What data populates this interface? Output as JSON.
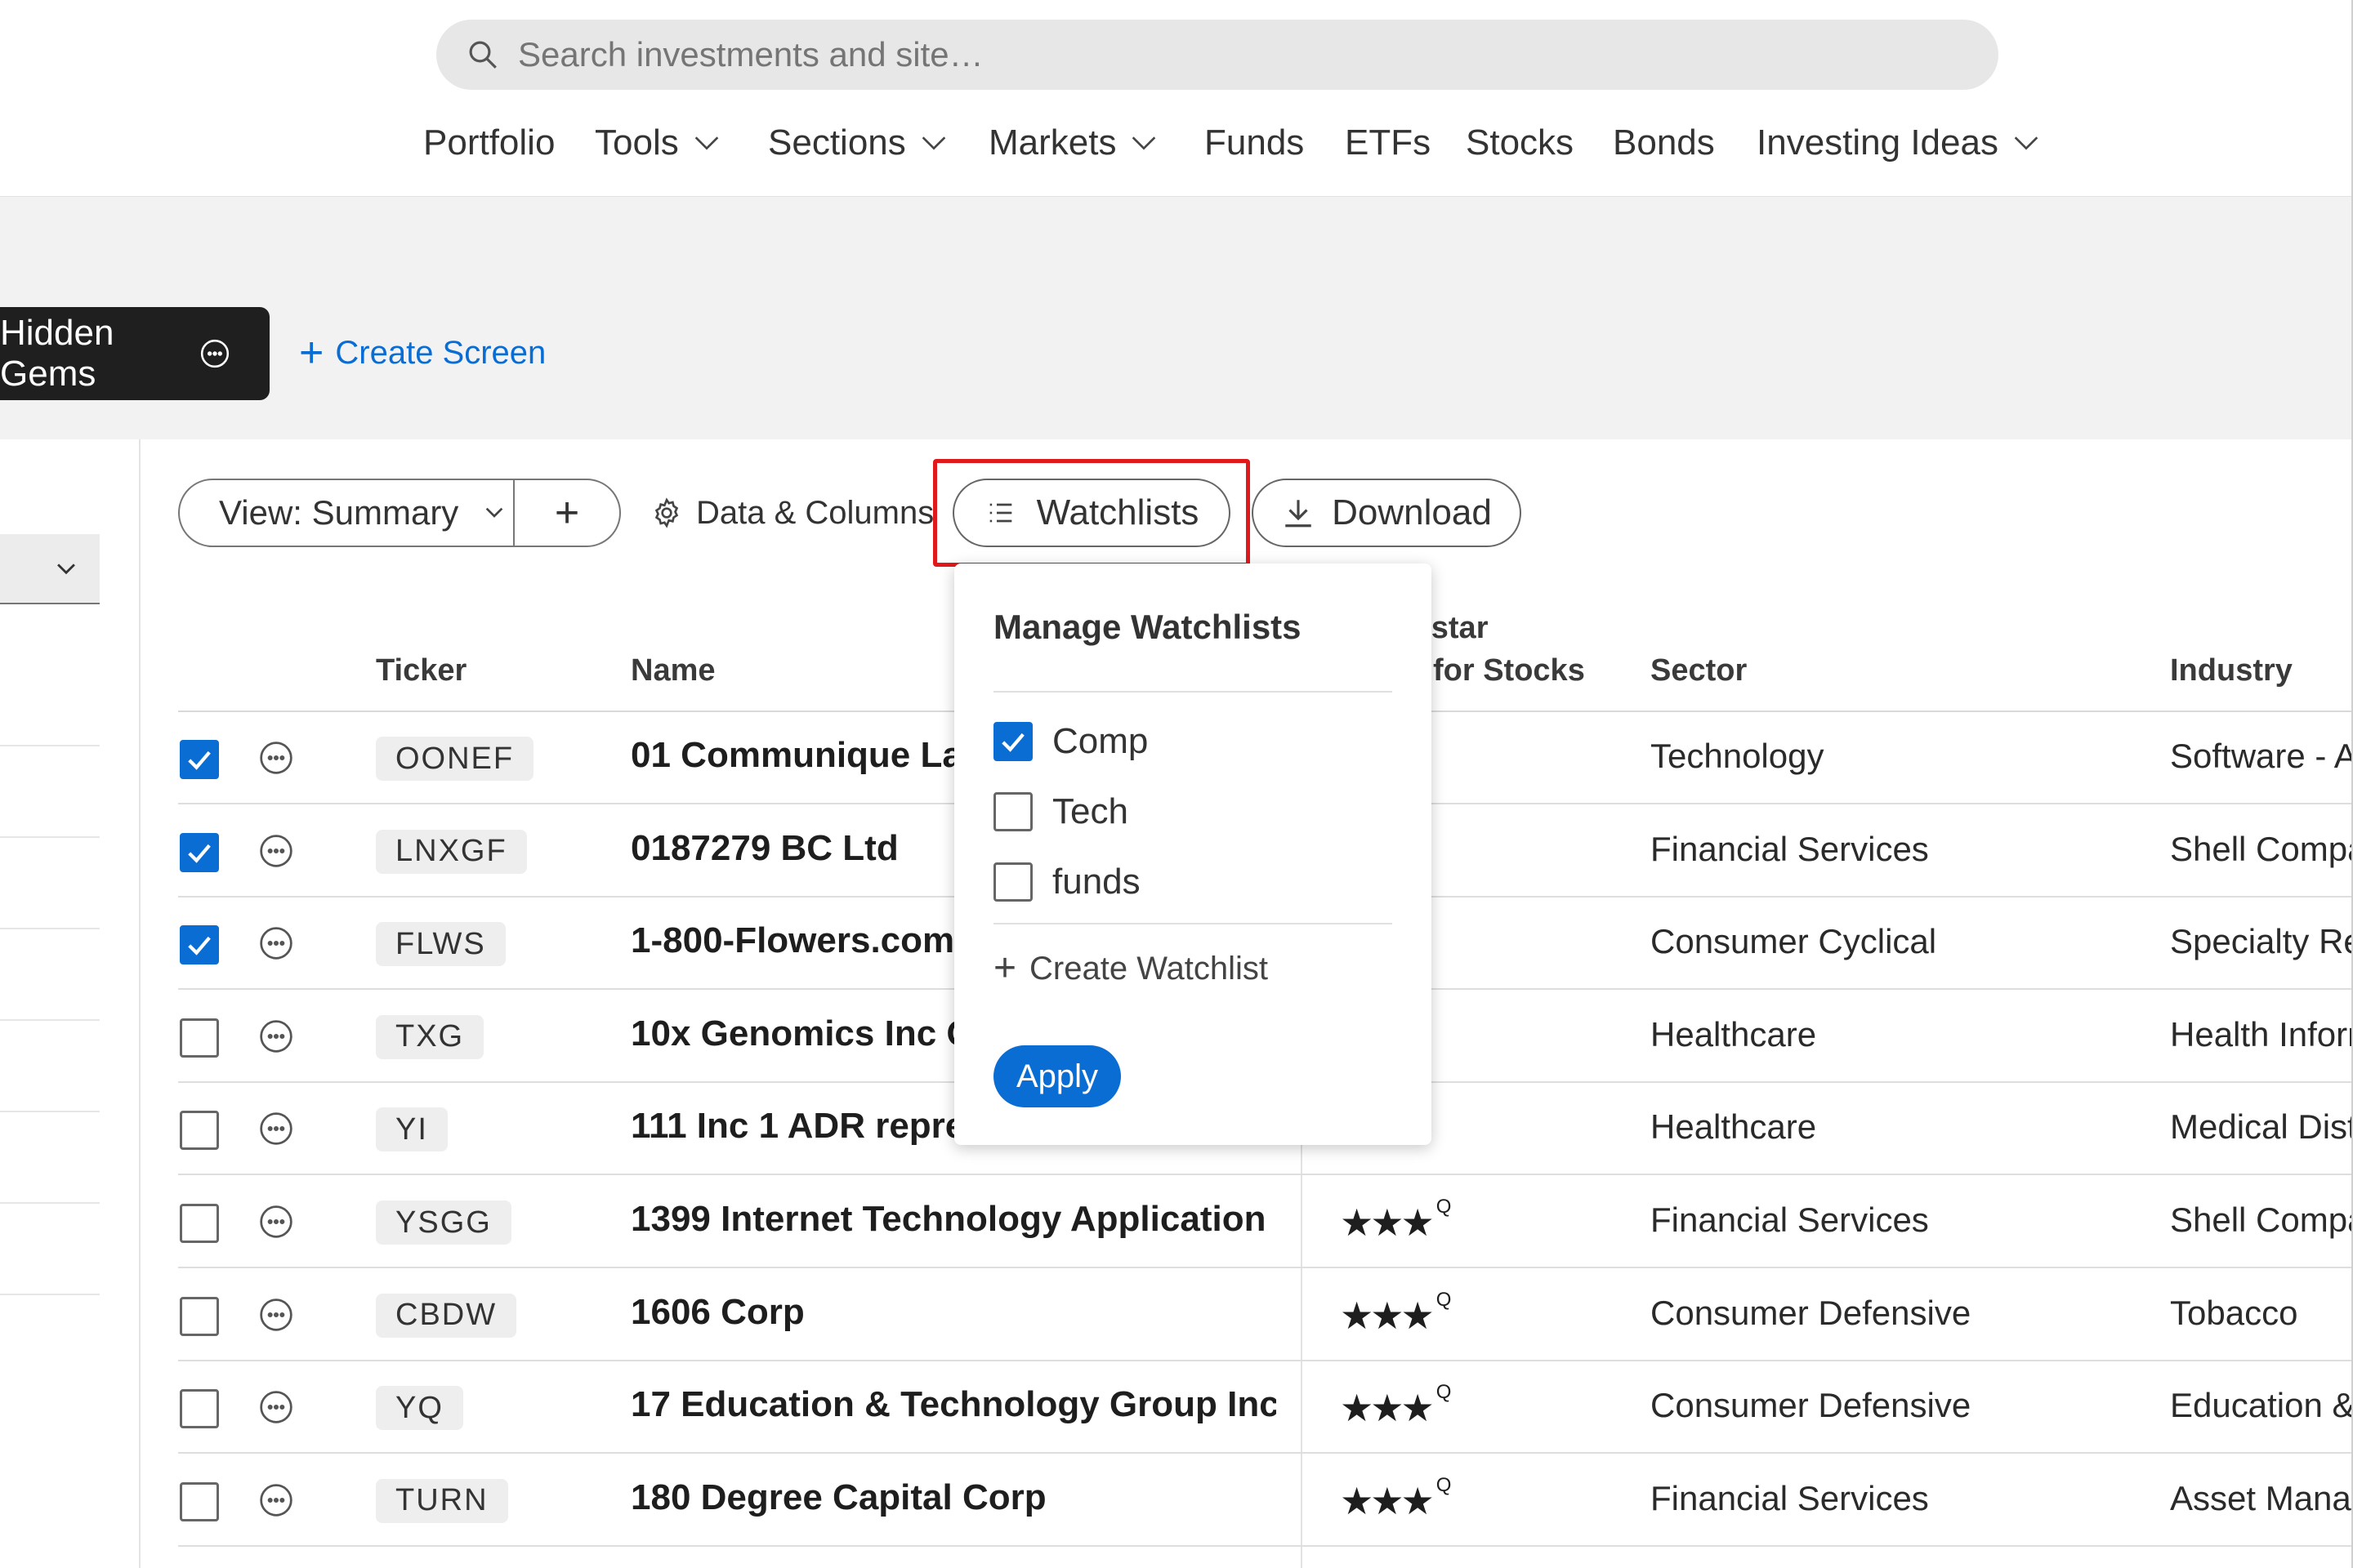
{
  "search": {
    "placeholder": "Search investments and site…"
  },
  "nav": {
    "items": [
      {
        "label": "Portfolio",
        "has_menu": false
      },
      {
        "label": "Tools",
        "has_menu": true
      },
      {
        "label": "Sections",
        "has_menu": true
      },
      {
        "label": "Markets",
        "has_menu": true
      },
      {
        "label": "Funds",
        "has_menu": false
      },
      {
        "label": "ETFs",
        "has_menu": false
      },
      {
        "label": "Stocks",
        "has_menu": false
      },
      {
        "label": "Bonds",
        "has_menu": false
      },
      {
        "label": "Investing Ideas",
        "has_menu": true
      }
    ]
  },
  "screens": {
    "active_tab": "Hidden Gems",
    "create_label": "Create Screen"
  },
  "toolbar": {
    "view_label": "View: Summary",
    "add_label": "+",
    "data_columns_label": "Data & Columns",
    "watchlists_label": "Watchlists",
    "download_label": "Download"
  },
  "table": {
    "headers": {
      "ticker": "Ticker",
      "name": "Name",
      "rating_line1": "ıgstar",
      "rating_line2": "for Stocks",
      "sector": "Sector",
      "industry": "Industry"
    },
    "rows": [
      {
        "checked": true,
        "ticker": "OONEF",
        "name": "01 Communique Labor",
        "stars": "★",
        "sector": "Technology",
        "industry": "Software - Ap"
      },
      {
        "checked": true,
        "ticker": "LNXGF",
        "name": "0187279 BC Ltd",
        "stars": "★",
        "sector": "Financial Services",
        "industry": "Shell Compar"
      },
      {
        "checked": true,
        "ticker": "FLWS",
        "name": "1-800-Flowers.com In",
        "stars": "★★",
        "sector": "Consumer Cyclical",
        "industry": "Specialty Reta"
      },
      {
        "checked": false,
        "ticker": "TXG",
        "name": "10x Genomics Inc Ord",
        "stars": "★",
        "sector": "Healthcare",
        "industry": "Health Inform"
      },
      {
        "checked": false,
        "ticker": "YI",
        "name": "111 Inc 1 ADR represe",
        "stars": "★",
        "sector": "Healthcare",
        "industry": "Medical Distr"
      },
      {
        "checked": false,
        "ticker": "YSGG",
        "name": "1399 Internet Technology Application Gr…",
        "stars": "★★★",
        "sector": "Financial Services",
        "industry": "Shell Compar"
      },
      {
        "checked": false,
        "ticker": "CBDW",
        "name": "1606 Corp",
        "stars": "★★★",
        "sector": "Consumer Defensive",
        "industry": "Tobacco"
      },
      {
        "checked": false,
        "ticker": "YQ",
        "name": "17 Education & Technology Group Inc ADR",
        "stars": "★★★",
        "sector": "Consumer Defensive",
        "industry": "Education & T"
      },
      {
        "checked": false,
        "ticker": "TURN",
        "name": "180 Degree Capital Corp",
        "stars": "★★★",
        "sector": "Financial Services",
        "industry": "Asset Manag"
      }
    ],
    "rating_suffix": "Q"
  },
  "watchlist_menu": {
    "title": "Manage Watchlists",
    "items": [
      {
        "label": "Comp",
        "checked": true
      },
      {
        "label": "Tech",
        "checked": false
      },
      {
        "label": "funds",
        "checked": false
      }
    ],
    "create_label": "Create Watchlist",
    "apply_label": "Apply"
  },
  "colors": {
    "accent": "#0a6dd3",
    "highlight": "#e0191d",
    "tab_dark": "#1f1f1f"
  }
}
